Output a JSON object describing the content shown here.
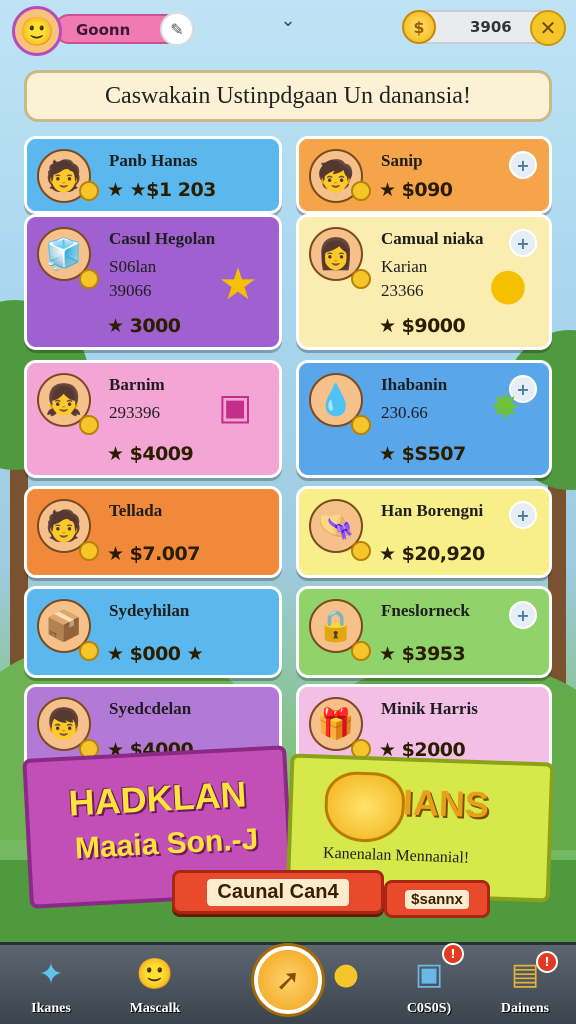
{
  "header": {
    "player_name": "Goonn",
    "currency_value": "3906",
    "icons": {
      "avatar": "player-avatar",
      "name_action": "edit-icon",
      "dropdown": "chevron-down-icon",
      "currency": "coin-icon",
      "close": "close-icon"
    }
  },
  "banner": {
    "text": "Caswakain Ustinpdgaan Un danansia!"
  },
  "cards": [
    {
      "title": "Panb Hanas",
      "sub1": "",
      "sub2": "",
      "price": "★ ★$1 203",
      "color": "#5bb8ef"
    },
    {
      "title": "Sanip",
      "sub1": "",
      "sub2": "",
      "price": "★ $090",
      "color": "#f5a44a"
    },
    {
      "title": "Casul Hegolan",
      "sub1": "S06lan",
      "sub2": "39066",
      "price": "★ 3000",
      "color": "#9e61cf"
    },
    {
      "title": "Camual niaka",
      "sub1": "Karian",
      "sub2": "23366",
      "price": "★ $9000",
      "color": "#fbecb0"
    },
    {
      "title": "Barnim",
      "sub1": "293396",
      "sub2": "",
      "price": "★ $4009",
      "color": "#f3a6d6"
    },
    {
      "title": "Ihabanin",
      "sub1": "230.66",
      "sub2": "",
      "price": "★ $S507",
      "color": "#5aa6ea"
    },
    {
      "title": "Tellada",
      "sub1": "",
      "sub2": "",
      "price": "★ $7.007",
      "color": "#f08a3a"
    },
    {
      "title": "Han Borengni",
      "sub1": "",
      "sub2": "",
      "price": "★ $20,920",
      "color": "#f8ee8a"
    },
    {
      "title": "Sydeyhilan",
      "sub1": "",
      "sub2": "",
      "price": "★ $000 ★",
      "color": "#5bb8ef"
    },
    {
      "title": "Fneslorneck",
      "sub1": "",
      "sub2": "",
      "price": "★ $3953",
      "color": "#8fd36a"
    },
    {
      "title": "Syedcdelan",
      "sub1": "",
      "sub2": "",
      "price": "★ $4000",
      "color": "#b27ad6"
    },
    {
      "title": "Minik Harris",
      "sub1": "",
      "sub2": "",
      "price": "★ $2000",
      "color": "#f3bfe6"
    }
  ],
  "promo": {
    "left_line1": "HADKLAN",
    "left_line2": "Maaia Son.-J",
    "left_cta": "Caunal Can4",
    "right_title": "IANS",
    "right_sub": "Kanenalan Mennanial!",
    "right_cta": "$sannx"
  },
  "nav": {
    "items": [
      {
        "label": "Ikanes",
        "icon": "star-fish-icon"
      },
      {
        "label": "Mascalk",
        "icon": "character-icon"
      },
      {
        "label": "",
        "icon": "play-icon"
      },
      {
        "label": "C0S0S)",
        "icon": "toolbox-icon",
        "badge": "!"
      },
      {
        "label": "Dainens",
        "icon": "chest-icon",
        "badge": "!"
      }
    ]
  }
}
